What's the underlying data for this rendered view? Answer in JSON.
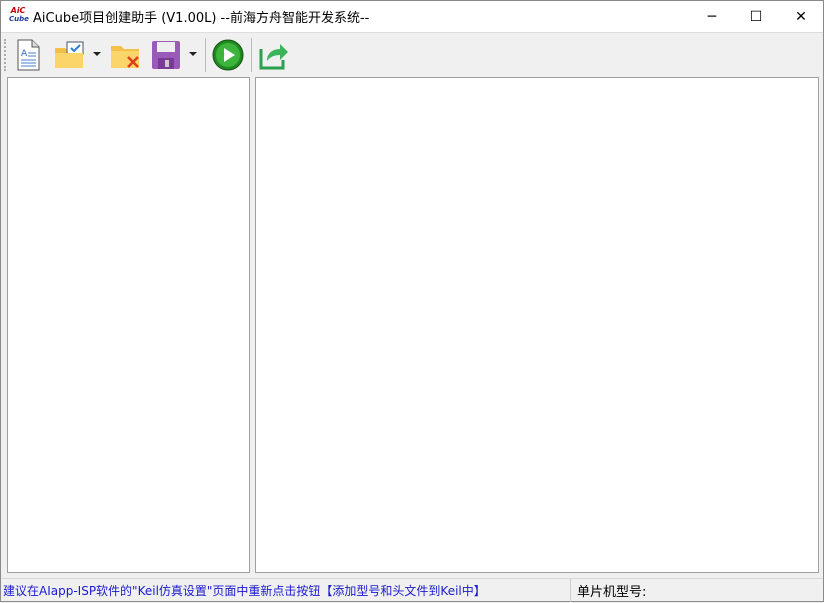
{
  "window": {
    "title": "AiCube项目创建助手 (V1.00L) --前海方舟智能开发系统--",
    "logo_top": "AiC",
    "logo_bottom": "Cube",
    "minimize": "─",
    "maximize": "☐",
    "close": "✕"
  },
  "toolbar": {
    "items": [
      {
        "name": "new-file-icon"
      },
      {
        "name": "open-project-icon"
      },
      {
        "name": "close-project-icon"
      },
      {
        "name": "save-icon"
      },
      {
        "name": "run-icon"
      },
      {
        "name": "export-icon"
      }
    ]
  },
  "status": {
    "hint": "建议在AIapp-ISP软件的\"Keil仿真设置\"页面中重新点击按钮【添加型号和头文件到Keil中】",
    "mcu_label": "单片机型号:"
  }
}
